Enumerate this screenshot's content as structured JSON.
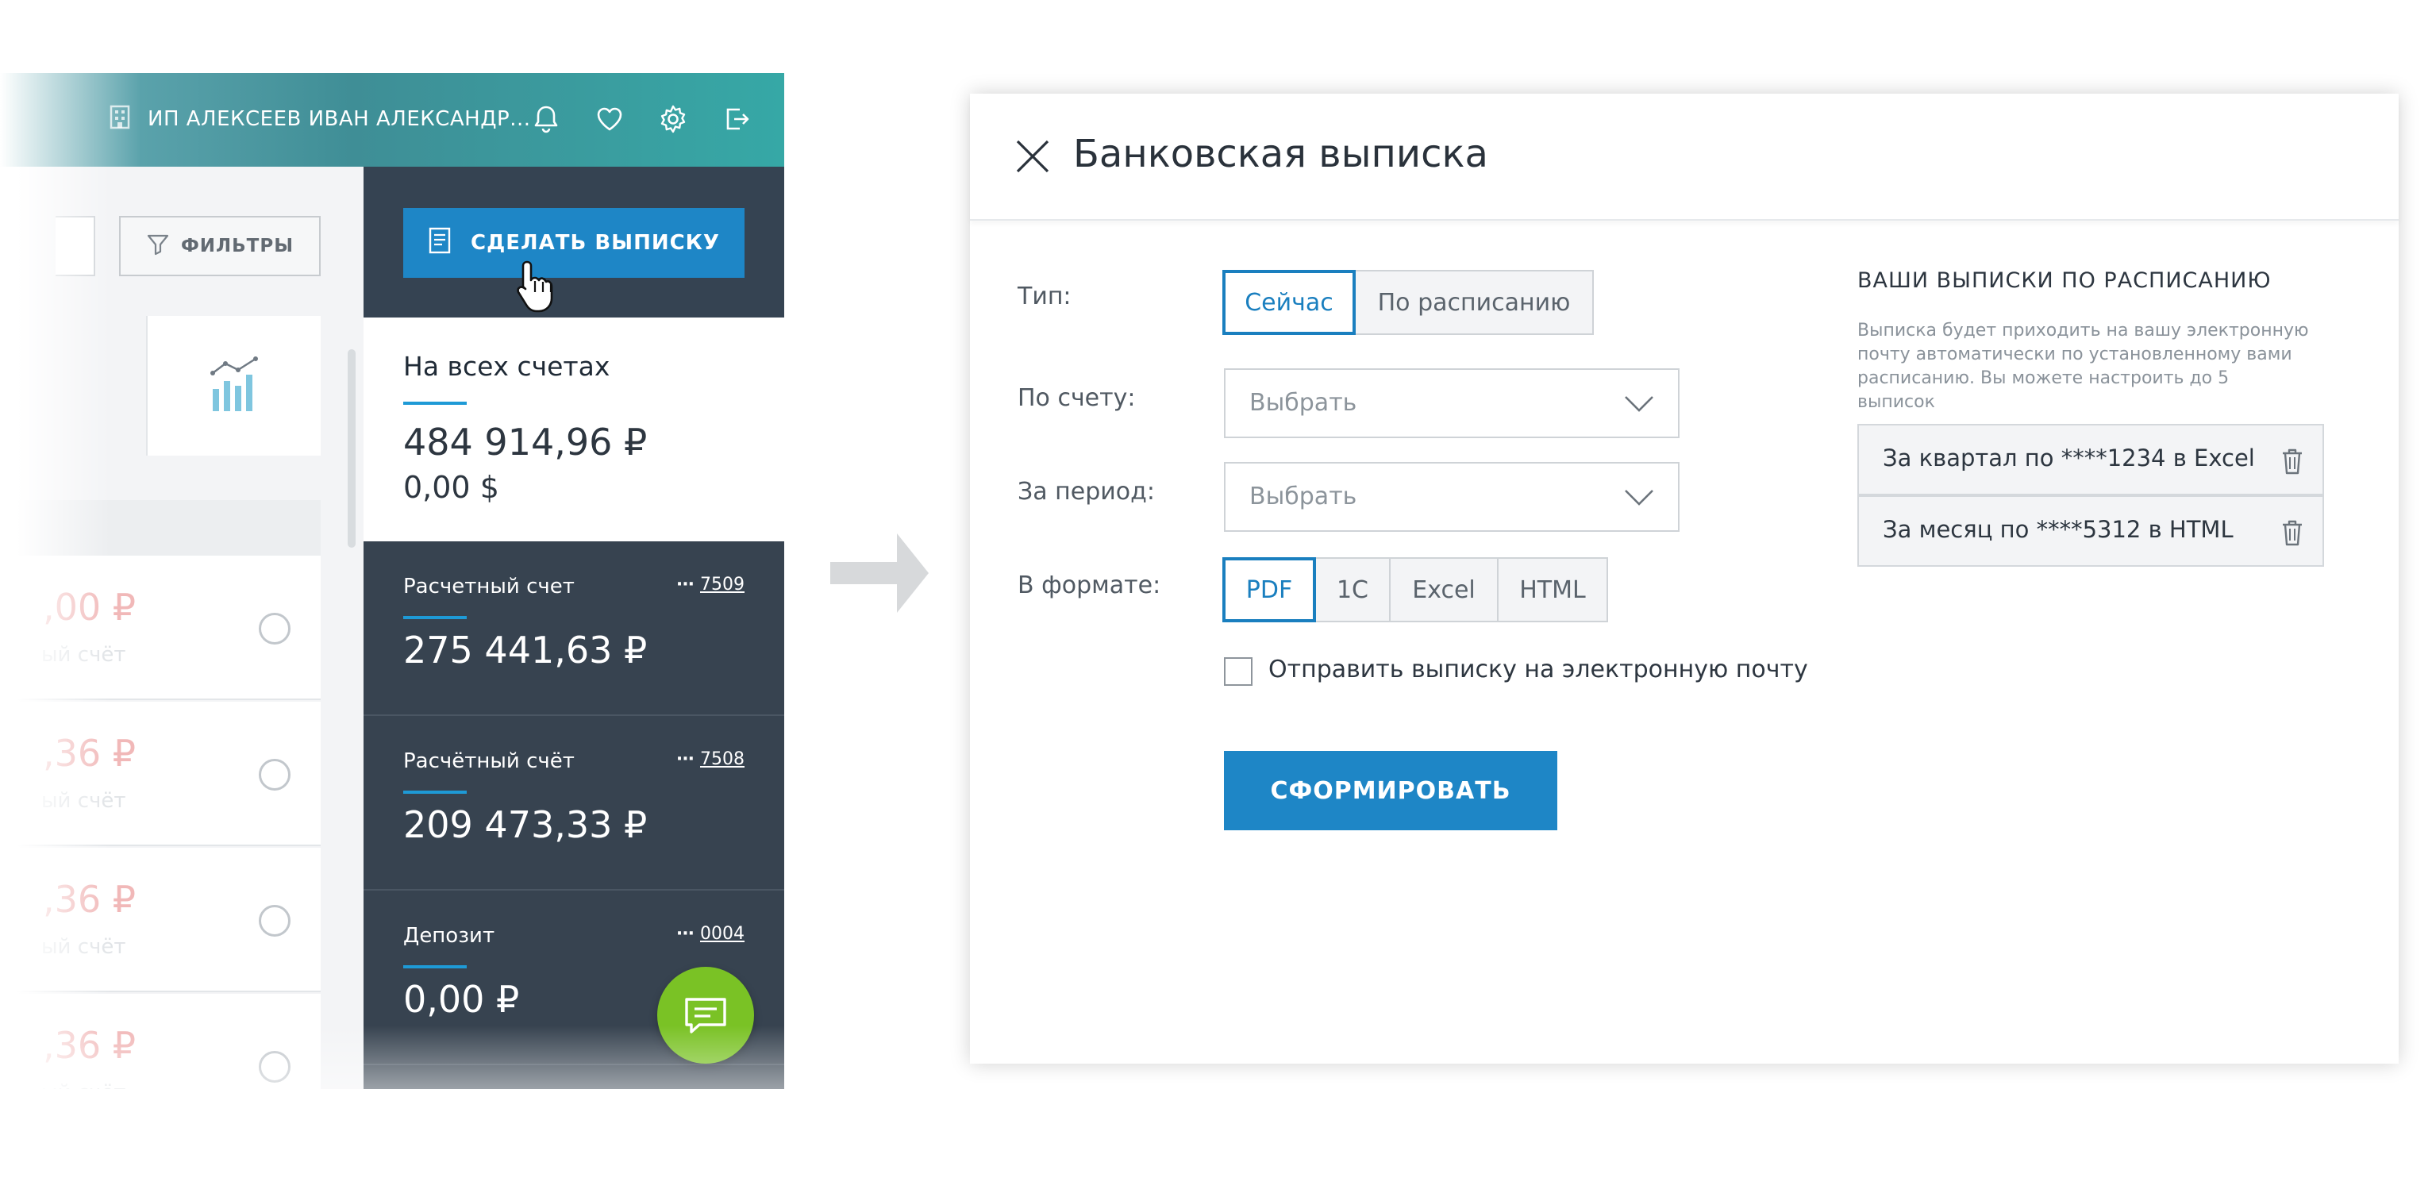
{
  "left_screen": {
    "org_name": "ИП АЛЕКСЕЕВ ИВАН АЛЕКСАНДР...",
    "filters_label": "ФИЛЬТРЫ",
    "make_statement_label": "СДЕЛАТЬ ВЫПИСКУ",
    "list_rows": [
      {
        "amount": ",00 ₽",
        "subtitle": "ый счёт"
      },
      {
        "amount": ",36 ₽",
        "subtitle": "ый счёт"
      },
      {
        "amount": ",36 ₽",
        "subtitle": "ый счёт"
      },
      {
        "amount": ",36 ₽",
        "subtitle": "ый счёт"
      }
    ],
    "all_accounts": {
      "title": "На всех счетах",
      "rub": "484 914,96 ₽",
      "usd": "0,00 $"
    },
    "accounts": [
      {
        "name": "Расчетный счет",
        "dots": "···",
        "number": "7509",
        "balance": "275 441,63 ₽"
      },
      {
        "name": "Расчётный счёт",
        "dots": "···",
        "number": "7508",
        "balance": "209 473,33 ₽"
      },
      {
        "name": "Депозит",
        "dots": "···",
        "number": "0004",
        "balance": "0,00 ₽"
      }
    ],
    "colors": {
      "accent_blue": "#1e86c6",
      "chat_green": "#7ac225",
      "panel_dark": "#374350"
    }
  },
  "modal": {
    "title": "Банковская выписка",
    "type_label": "Тип:",
    "type_options": [
      "Сейчас",
      "По расписанию"
    ],
    "type_selected": "Сейчас",
    "account_label": "По счету:",
    "account_placeholder": "Выбрать",
    "period_label": "За период:",
    "period_placeholder": "Выбрать",
    "format_label": "В формате:",
    "format_options": [
      "PDF",
      "1С",
      "Excel",
      "HTML"
    ],
    "format_selected": "PDF",
    "email_checkbox_label": "Отправить выписку на электронную почту",
    "email_checked": false,
    "submit_label": "СФОРМИРОВАТЬ",
    "schedule": {
      "title": "ВАШИ ВЫПИСКИ ПО РАСПИСАНИЮ",
      "description": "Выписка будет приходить на вашу электронную почту автоматически по установленному вами расписанию. Вы можете настроить до 5 выписок",
      "items": [
        "За квартал по ****1234 в Excel",
        "За месяц по ****5312 в HTML"
      ]
    }
  }
}
